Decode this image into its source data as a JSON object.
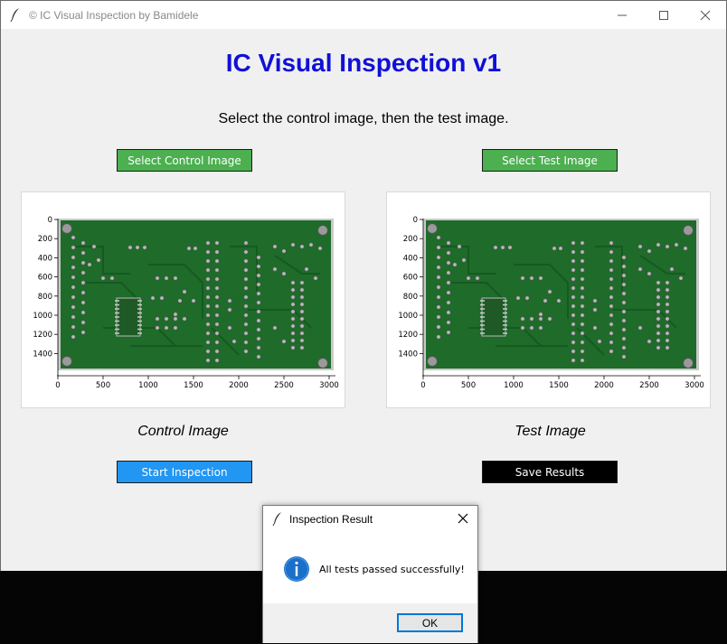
{
  "window": {
    "title": "© IC Visual Inspection by Bamidele",
    "controls": [
      "minimize-icon",
      "maximize-icon",
      "close-icon"
    ]
  },
  "main": {
    "app_title": "IC Visual Inspection v1",
    "instructions": "Select the control image, then the test image.",
    "select_control_label": "Select Control Image",
    "select_test_label": "Select Test Image",
    "control_caption": "Control Image",
    "test_caption": "Test Image",
    "start_label": "Start Inspection",
    "save_label": "Save Results",
    "plot": {
      "y_ticks": [
        "0",
        "200",
        "400",
        "600",
        "800",
        "1000",
        "1200",
        "1400"
      ],
      "x_ticks": [
        "0",
        "500",
        "1000",
        "1500",
        "2000",
        "2500",
        "3000"
      ]
    }
  },
  "dialog": {
    "title": "Inspection Result",
    "message": "All tests passed successfully!",
    "ok_label": "OK",
    "icon": "info-icon"
  },
  "colors": {
    "title_blue": "#1010d8",
    "green_button": "#4caf50",
    "blue_button": "#2196f3",
    "black_button": "#000000",
    "pcb_green": "#1e6b2a"
  }
}
